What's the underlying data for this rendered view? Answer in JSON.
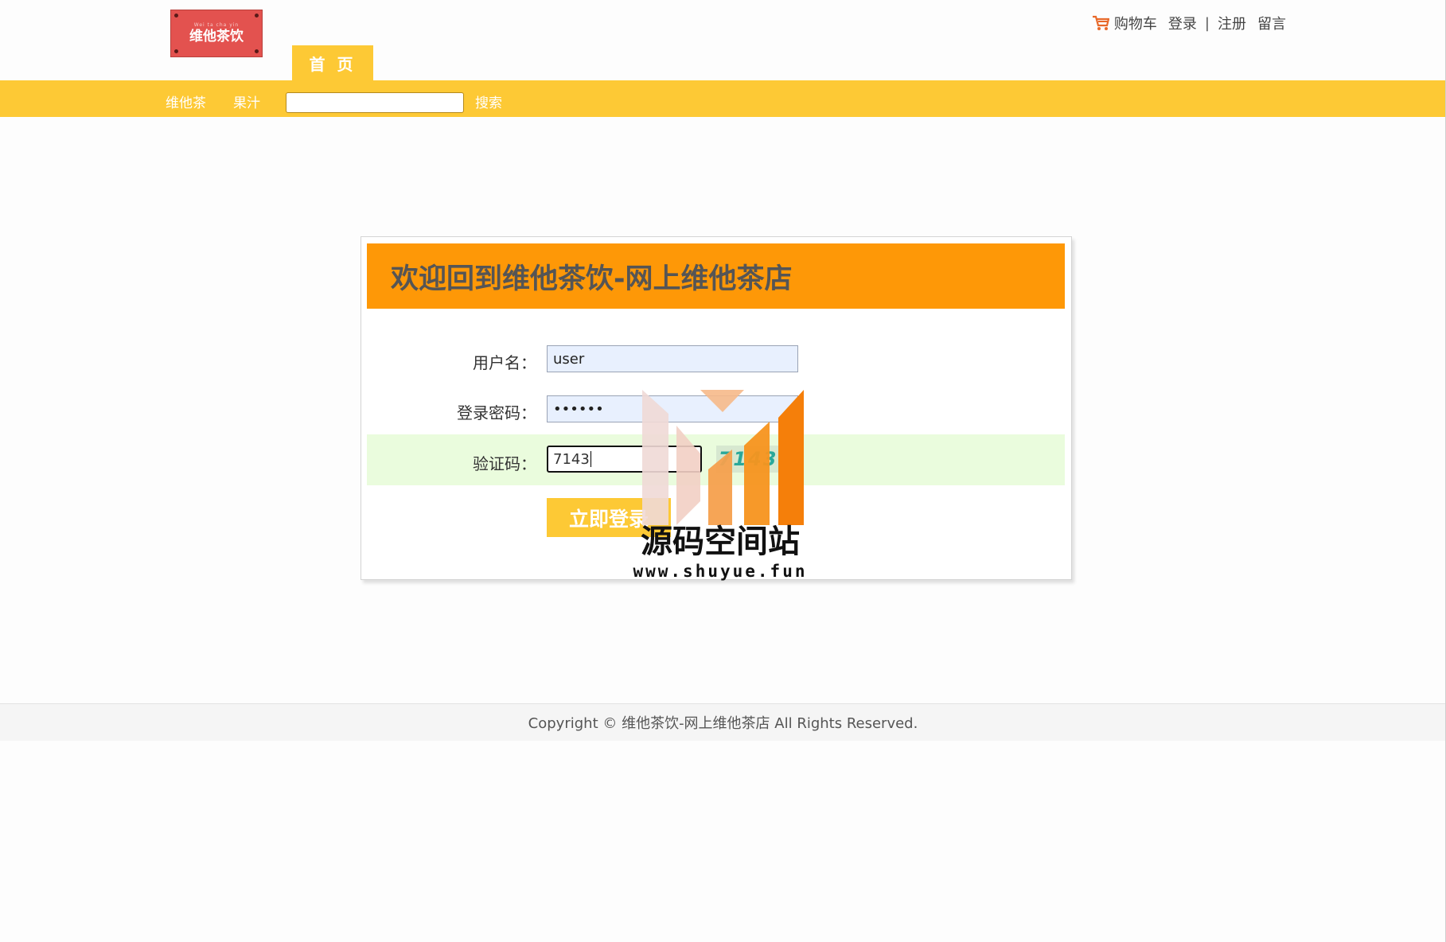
{
  "header": {
    "logo_text": "维他茶饮",
    "logo_subtext": "Wei ta cha yin",
    "cart_label": "购物车",
    "login_label": "登录",
    "separator": "|",
    "register_label": "注册",
    "message_label": "留言",
    "home_tab": "首 页"
  },
  "nav": {
    "items": [
      "维他茶",
      "果汁"
    ],
    "search_value": "",
    "search_label": "搜索"
  },
  "login": {
    "title": "欢迎回到维他茶饮-网上维他茶店",
    "username_label": "用户名：",
    "username_value": "user",
    "password_label": "登录密码：",
    "password_value": "••••••",
    "captcha_label": "验证码：",
    "captcha_value": "7143",
    "captcha_image_text": "7143",
    "submit_label": "立即登录"
  },
  "watermark": {
    "title": "源码空间站",
    "url": "www.shuyue.fun"
  },
  "footer": {
    "copyright": "Copyright © 维他茶饮-网上维他茶店 All Rights Reserved."
  },
  "colors": {
    "nav_yellow": "#fdc935",
    "header_orange": "#fe9807",
    "captcha_row": "#eafcdd",
    "logo_red": "#e3524f"
  },
  "icons": {
    "cart": "cart-icon"
  }
}
